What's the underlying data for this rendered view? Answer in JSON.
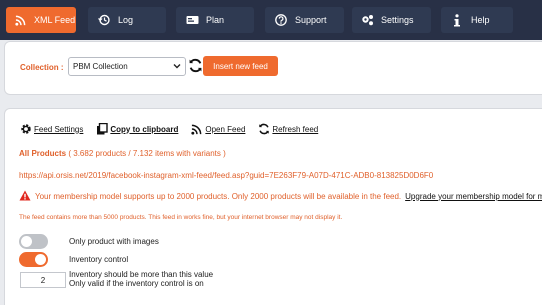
{
  "nav": {
    "items": [
      {
        "label": "XML Feed",
        "icon": "rss-icon"
      },
      {
        "label": "Log",
        "icon": "history-icon"
      },
      {
        "label": "Plan",
        "icon": "plan-icon"
      },
      {
        "label": "Support",
        "icon": "help-circle-icon"
      },
      {
        "label": "Settings",
        "icon": "gears-icon"
      },
      {
        "label": "Help",
        "icon": "info-icon"
      }
    ],
    "active": "XML Feed",
    "accent": "#ef6a2e",
    "background": "#283046"
  },
  "collection": {
    "label": "Collection :",
    "selected": "PBM Collection",
    "insert_button": "Insert new feed"
  },
  "feed": {
    "actions": {
      "settings": "Feed Settings",
      "copy": "Copy to clipboard",
      "open": "Open Feed",
      "refresh": "Refresh feed"
    },
    "all_products_label": "All Products",
    "all_products_count": "( 3.682 products / 7.132 items with variants )",
    "url": "https://api.orsis.net/2019/facebook-instagram-xml-feed/feed.asp?guid=7E263F79-A07D-471C-ADB0-813825D0D6F0",
    "warning": "Your membership model supports up to 2000 products. Only 2000 products will be available in the feed.",
    "upgrade_link": "Upgrade your membership model for m",
    "too_many_notice": "The feed contains more than 5000 products. This feed in works fine, but your internet browser may not display it."
  },
  "options": {
    "only_images_label": "Only product with images",
    "only_images_on": false,
    "inventory_control_label": "Inventory control",
    "inventory_control_on": true,
    "min_inventory_value": "2",
    "min_inventory_line1": "Inventory should be more than this value",
    "min_inventory_line2": "Only valid if the inventory control is on"
  }
}
